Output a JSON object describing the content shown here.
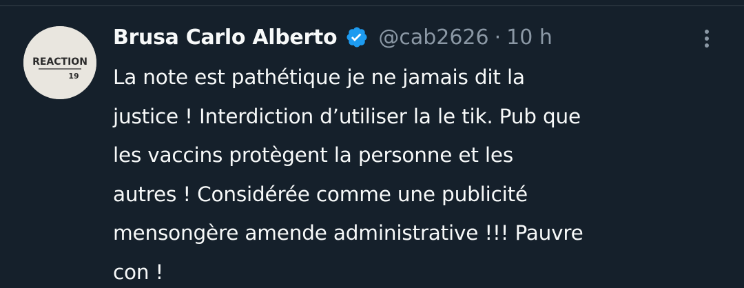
{
  "tweet": {
    "display_name": "Brusa Carlo Alberto",
    "handle": "@cab2626",
    "separator": "·",
    "time": "10 h",
    "verified": true,
    "avatar_text": "REACTION",
    "avatar_subtext": "19",
    "body_lines": [
      "La note est pathétique je ne jamais dit la",
      "justice ! Interdiction d’utiliser la le tik. Pub que",
      "les vaccins protègent la personne et les",
      "autres ! Considérée comme une publicité",
      "mensongère amende administrative !!! Pauvre",
      "con !"
    ]
  },
  "colors": {
    "background": "#15202b",
    "text_primary": "#f7f9f9",
    "text_secondary": "#8b98a5",
    "verified_badge": "#1d9bf0",
    "divider": "#38444d"
  },
  "icons": {
    "verified": "verified-badge-icon",
    "more": "more-vertical-icon"
  }
}
